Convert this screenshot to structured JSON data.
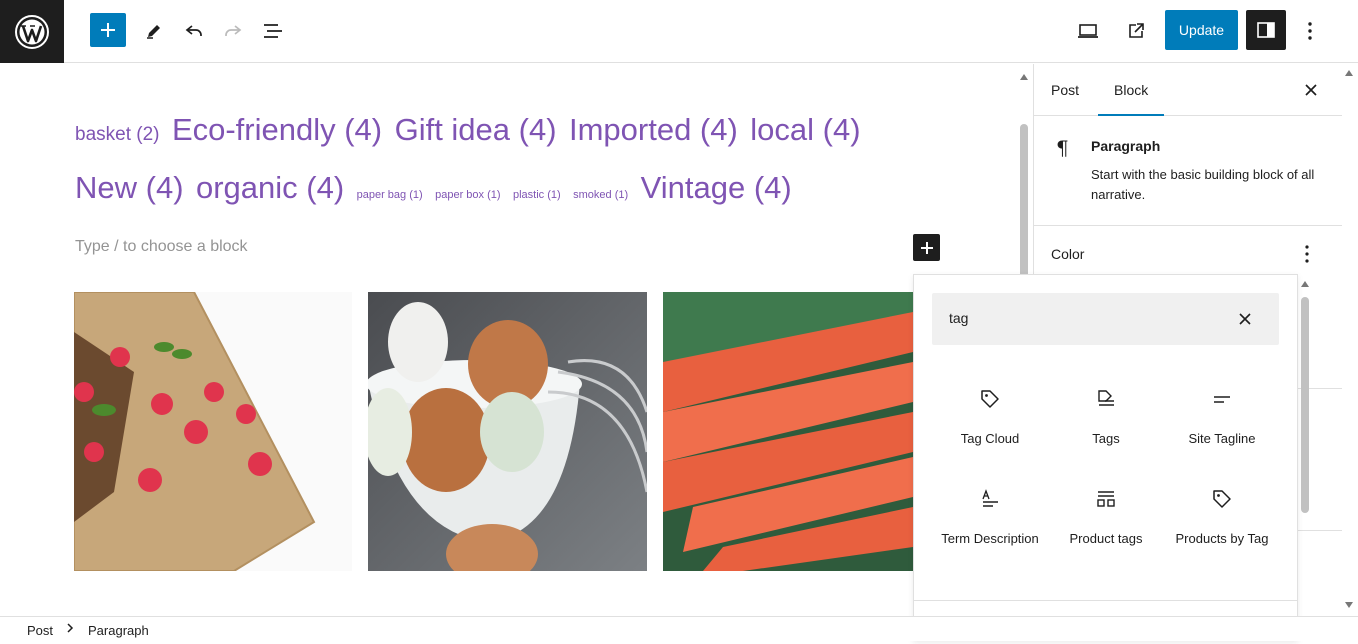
{
  "toolbar": {
    "update_label": "Update"
  },
  "editor": {
    "tags": [
      {
        "text": "basket (2)",
        "size": "mid"
      },
      {
        "text": "Eco-friendly (4)",
        "size": "big"
      },
      {
        "text": "Gift idea (4)",
        "size": "big"
      },
      {
        "text": "Imported (4)",
        "size": "big"
      },
      {
        "text": "local (4)",
        "size": "big"
      },
      {
        "text": "New (4)",
        "size": "big"
      },
      {
        "text": "organic (4)",
        "size": "big"
      },
      {
        "text": "paper bag (1)",
        "size": "small"
      },
      {
        "text": "paper box (1)",
        "size": "small"
      },
      {
        "text": "plastic (1)",
        "size": "small"
      },
      {
        "text": "smoked (1)",
        "size": "small"
      },
      {
        "text": "Vintage (4)",
        "size": "big"
      }
    ],
    "placeholder": "Type / to choose a block",
    "tag_color": "#7f54b3"
  },
  "sidebar": {
    "tabs": [
      "Post",
      "Block"
    ],
    "active_tab": "Block",
    "block_title": "Paragraph",
    "block_description": "Start with the basic building block of all narrative.",
    "color_panel_title": "Color"
  },
  "inserter": {
    "search_value": "tag",
    "results": [
      {
        "label": "Tag Cloud",
        "icon": "tag-icon"
      },
      {
        "label": "Tags",
        "icon": "tags-icon"
      },
      {
        "label": "Site Tagline",
        "icon": "tagline-icon"
      },
      {
        "label": "Term Description",
        "icon": "term-description-icon"
      },
      {
        "label": "Product tags",
        "icon": "product-tags-icon"
      },
      {
        "label": "Products by Tag",
        "icon": "products-by-tag-icon"
      }
    ]
  },
  "breadcrumb": {
    "items": [
      "Post",
      "Paragraph"
    ]
  },
  "colors": {
    "accent": "#007cba",
    "dark": "#1e1e1e"
  }
}
